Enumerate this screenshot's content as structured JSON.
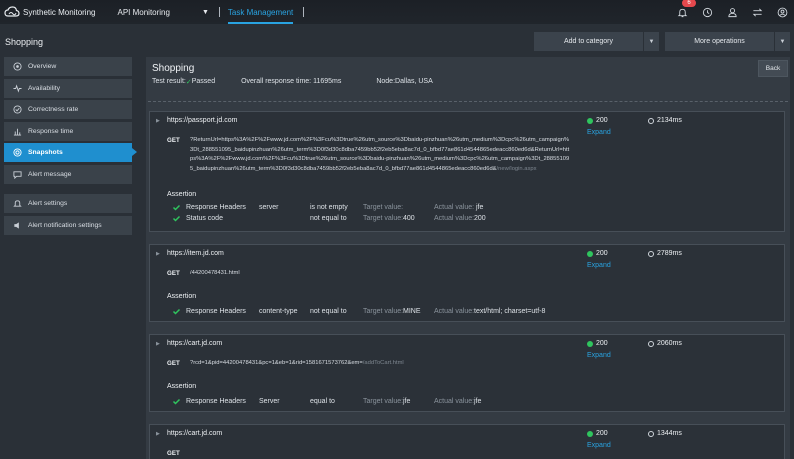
{
  "topbar": {
    "brand": "Synthetic Monitoring",
    "nav_api": "API Monitoring",
    "nav_caret": "▼",
    "nav_active": "Task Management",
    "notification_count": "6"
  },
  "subbar": {
    "title": "Shopping",
    "add_category": "Add to category",
    "more_operations": "More operations"
  },
  "sidebar": {
    "items": [
      {
        "label": "Overview",
        "icon": "overview-icon"
      },
      {
        "label": "Availability",
        "icon": "pulse-icon"
      },
      {
        "label": "Correctness rate",
        "icon": "check-circle-icon"
      },
      {
        "label": "Response time",
        "icon": "bar-chart-icon"
      },
      {
        "label": "Snapshots",
        "icon": "snapshot-icon",
        "active": true
      },
      {
        "label": "Alert message",
        "icon": "message-icon"
      }
    ],
    "settings": [
      {
        "label": "Alert settings",
        "icon": "bell-icon"
      },
      {
        "label": "Alert notification settings",
        "icon": "speaker-icon"
      }
    ]
  },
  "main": {
    "title": "Shopping",
    "test_result_label": "Test result:",
    "test_result_value": "Passed",
    "overall_response_time": "Overall response time: 11695ms",
    "node": "Node:Dallas, USA",
    "back": "Back"
  },
  "cards": [
    {
      "url": "https://passport.jd.com",
      "method": "GET",
      "request": "?ReturnUrl=https%3A%2F%2Fwww.jd.com%2F%3Fcu%3Dtrue%26utm_source%3Dbaidu-pinzhuan%26utm_medium%3Dcpc%26utm_campaign%3Dt_288551095_baidupinzhuan%26utm_term%3D0f3d30c8dba7459bb52f2eb5eba8ac7d_0_bfbd77ae861d4544865edeacc860ed6d&ReturnUrl=https%3A%2F%2Fwww.jd.com%2F%3Fcu%3Dtrue%26utm_source%3Dbaidu-pinzhuan%26utm_medium%3Dcpc%26utm_campaign%3Dt_288551095_baidupinzhuan%26utm_term%3D0f3d30c8dba7459bb52f2eb5eba8ac7d_0_bfbd77ae861d4544865edeacc860ed6d&",
      "request_dim": "/new/login.aspx",
      "status": "200",
      "expand": "Expand",
      "time": "2134ms",
      "assertion_title": "Assertion",
      "assertions": [
        {
          "type": "Response Headers",
          "field": "server",
          "op": "is not empty",
          "target_label": "Target value:",
          "target": "",
          "actual_label": "Actual value:",
          "actual": "jfe"
        },
        {
          "type": "Status code",
          "field": "",
          "op": "not equal to",
          "target_label": "Target value:",
          "target": "400",
          "actual_label": "Actual value:",
          "actual": "200"
        }
      ]
    },
    {
      "url": "https://item.jd.com",
      "method": "GET",
      "request": "/44200478431.html",
      "request_dim": "",
      "status": "200",
      "expand": "Expand",
      "time": "2789ms",
      "assertion_title": "Assertion",
      "assertions": [
        {
          "type": "Response Headers",
          "field": "content-type",
          "op": "not equal to",
          "target_label": "Target value:",
          "target": "MINE",
          "actual_label": "Actual value:",
          "actual": "text/html; charset=utf-8"
        }
      ]
    },
    {
      "url": "https://cart.jd.com",
      "method": "GET",
      "request": "?rcd=1&pid=44200478431&pc=1&eb=1&rid=1581671573762&em=",
      "request_dim": "/addToCart.html",
      "status": "200",
      "expand": "Expand",
      "time": "2060ms",
      "assertion_title": "Assertion",
      "assertions": [
        {
          "type": "Response Headers",
          "field": "Server",
          "op": "equal to",
          "target_label": "Target value:",
          "target": "jfe",
          "actual_label": "Actual value:",
          "actual": "jfe"
        }
      ]
    },
    {
      "url": "https://cart.jd.com",
      "method": "GET",
      "request": "",
      "request_dim": "",
      "status": "200",
      "expand": "Expand",
      "time": "1344ms"
    }
  ],
  "colors": {
    "accent": "#29a3e1",
    "success": "#2fc55e",
    "badge": "#e5484d"
  }
}
